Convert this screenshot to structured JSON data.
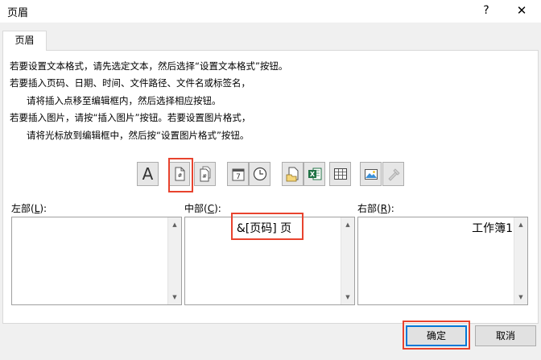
{
  "window": {
    "title": "页眉",
    "help_glyph": "?",
    "close_glyph": "✕"
  },
  "tab": {
    "label": "页眉"
  },
  "instructions": [
    "若要设置文本格式，请先选定文本，然后选择“设置文本格式”按钮。",
    "若要插入页码、日期、时间、文件路径、文件名或标签名，",
    "请将插入点移至编辑框内，然后选择相应按钮。",
    "若要插入图片，请按“插入图片”按钮。若要设置图片格式，",
    "请将光标放到编辑框中，然后按“设置图片格式”按钮。"
  ],
  "toolbar": {
    "buttons": [
      {
        "icon": "format-text-icon",
        "glyph": "A"
      },
      {
        "icon": "insert-page-number-icon"
      },
      {
        "icon": "insert-page-count-icon"
      },
      {
        "icon": "insert-date-icon",
        "glyph": "7"
      },
      {
        "icon": "insert-time-icon"
      },
      {
        "icon": "insert-file-path-icon"
      },
      {
        "icon": "insert-file-name-icon"
      },
      {
        "icon": "insert-sheet-name-icon"
      },
      {
        "icon": "insert-picture-icon"
      },
      {
        "icon": "format-picture-icon"
      }
    ],
    "highlight_color": "#e8432e"
  },
  "sections": {
    "left": {
      "label_pre": "左部(",
      "label_key": "L",
      "label_post": "):",
      "value": ""
    },
    "center": {
      "label_pre": "中部(",
      "label_key": "C",
      "label_post": "):",
      "value": "&[页码] 页"
    },
    "right": {
      "label_pre": "右部(",
      "label_key": "R",
      "label_post": "):",
      "value": "工作簿1"
    }
  },
  "buttons": {
    "ok_label": "确定",
    "cancel_label": "取消"
  },
  "colors": {
    "dialog_bg": "#f0f0f0",
    "accent": "#0078d7",
    "annotation": "#e8432e"
  }
}
